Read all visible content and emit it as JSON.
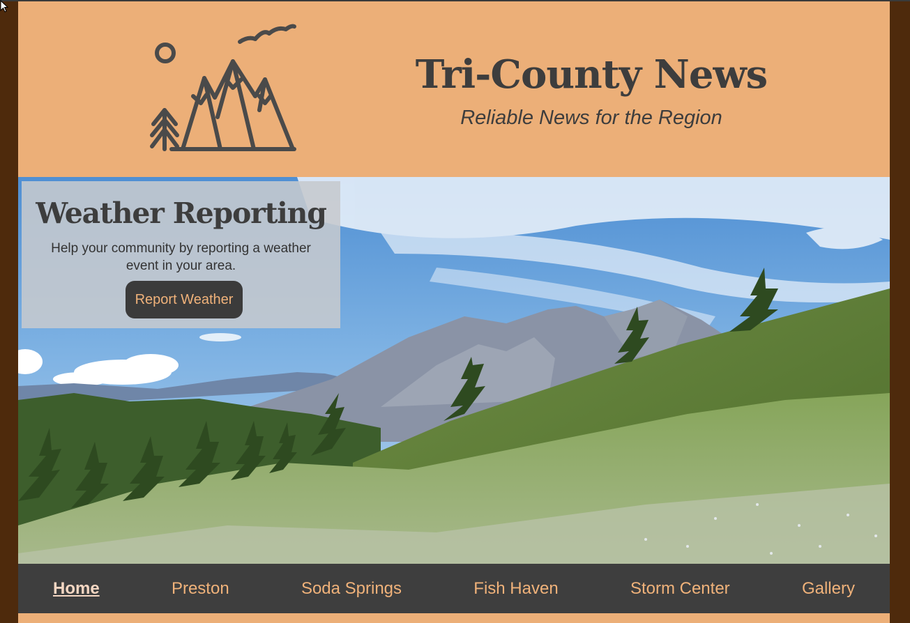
{
  "header": {
    "site_title": "Tri-County News",
    "tagline": "Reliable News for the Region",
    "logo_icon": "mountain-logo-icon"
  },
  "hero": {
    "card_title": "Weather Reporting",
    "card_text": "Help your community by reporting a weather event in your area.",
    "button_label": "Report Weather"
  },
  "nav": {
    "items": [
      {
        "label": "Home",
        "active": true
      },
      {
        "label": "Preston",
        "active": false
      },
      {
        "label": "Soda Springs",
        "active": false
      },
      {
        "label": "Fish Haven",
        "active": false
      },
      {
        "label": "Storm Center",
        "active": false
      },
      {
        "label": "Gallery",
        "active": false
      }
    ]
  },
  "colors": {
    "accent": "#ecaf78",
    "dark": "#3d3d3d",
    "frame": "#4e2a0c",
    "nav_bg": "#3e3e3e",
    "nav_text": "#f0b27a"
  }
}
